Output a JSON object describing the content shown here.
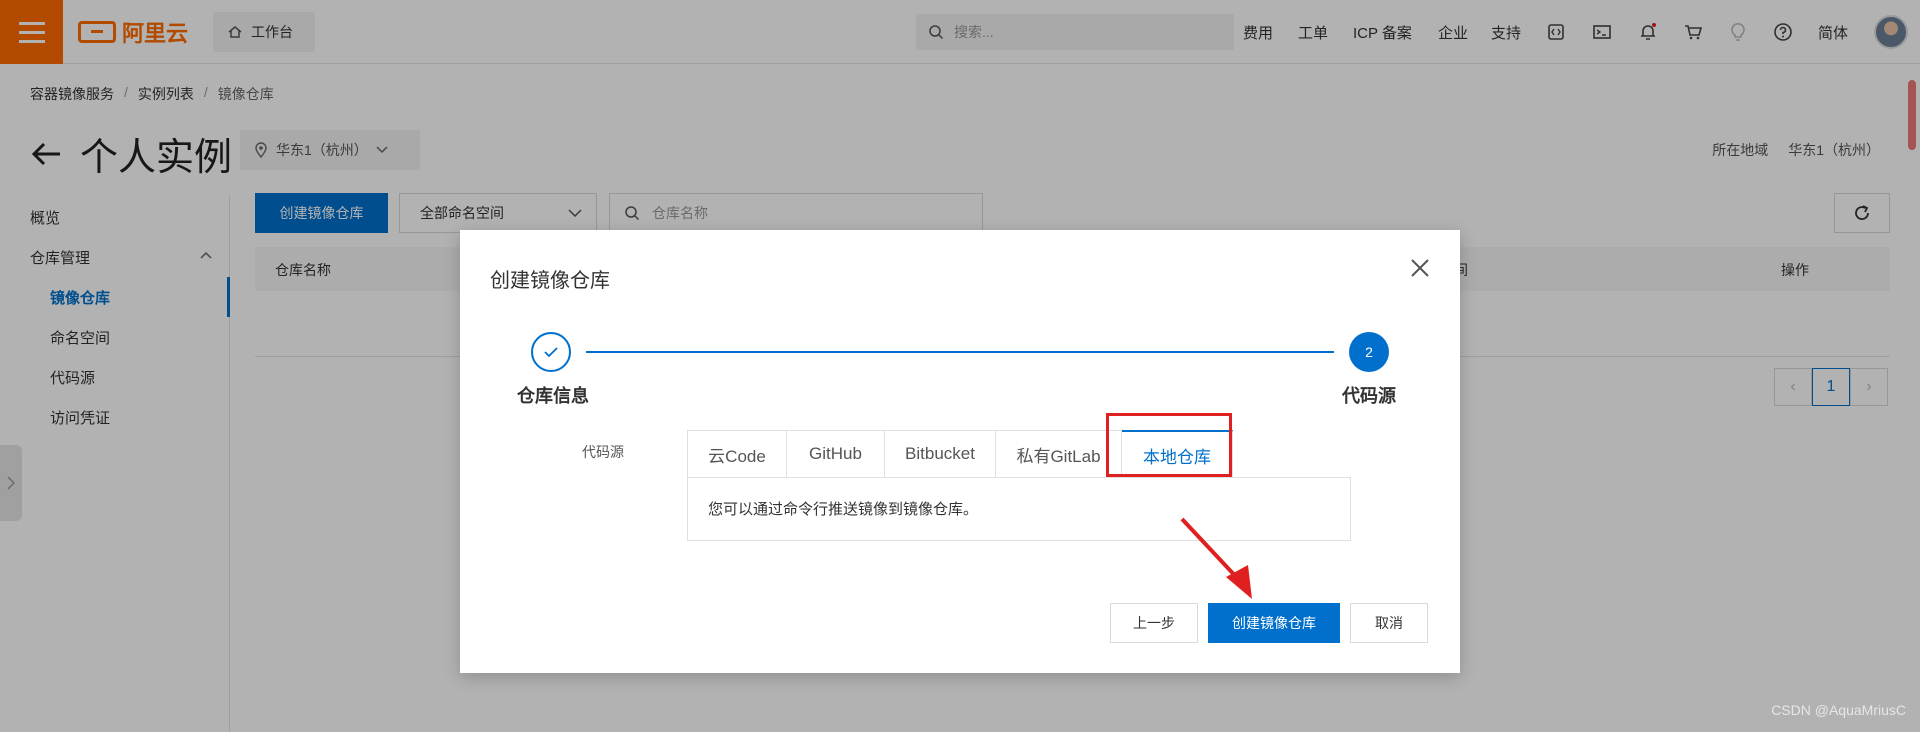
{
  "topbar": {
    "logo_text": "阿里云",
    "workbench": "工作台",
    "search_placeholder": "搜索...",
    "nav": [
      "费用",
      "工单",
      "ICP 备案",
      "企业",
      "支持"
    ],
    "lang": "简体"
  },
  "breadcrumb": [
    "容器镜像服务",
    "实例列表",
    "镜像仓库"
  ],
  "page": {
    "title": "个人实例",
    "region": "华东1（杭州）",
    "region_label": "所在地域",
    "region_value": "华东1（杭州）"
  },
  "sidebar": {
    "overview": "概览",
    "repo_mgmt": "仓库管理",
    "items": [
      "镜像仓库",
      "命名空间",
      "代码源",
      "访问凭证"
    ]
  },
  "toolbar": {
    "create": "创建镜像仓库",
    "namespace": "全部命名空间",
    "search_placeholder": "仓库名称"
  },
  "table": {
    "col_name": "仓库名称",
    "col_time": "时间",
    "col_ops": "操作"
  },
  "pager": {
    "current": "1"
  },
  "modal": {
    "title": "创建镜像仓库",
    "step1": "仓库信息",
    "step2": "代码源",
    "step2_num": "2",
    "source_label": "代码源",
    "tabs": [
      "云Code",
      "GitHub",
      "Bitbucket",
      "私有GitLab",
      "本地仓库"
    ],
    "content": "您可以通过命令行推送镜像到镜像仓库。",
    "prev": "上一步",
    "submit": "创建镜像仓库",
    "cancel": "取消"
  },
  "watermark": "CSDN @AquaMriusC",
  "colors": {
    "accent": "#0070cc",
    "brand": "#ff6a00",
    "highlight": "#e02020"
  }
}
